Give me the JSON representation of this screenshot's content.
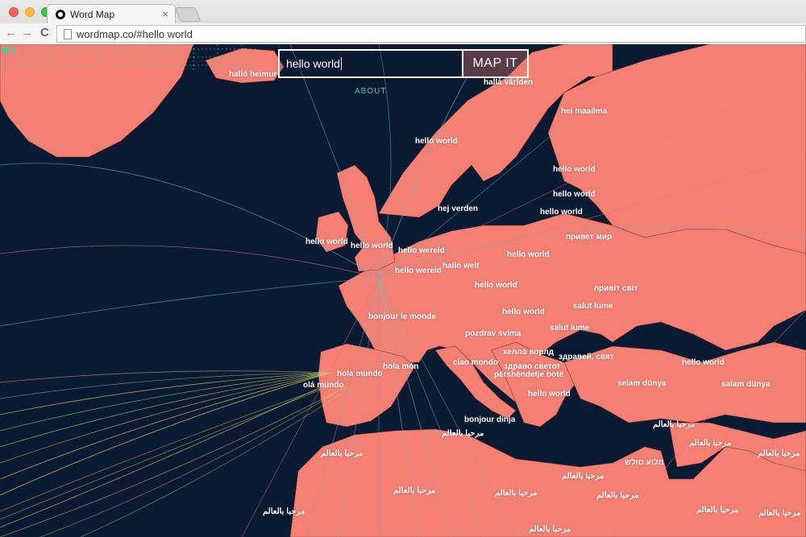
{
  "browser": {
    "tab_title": "Word Map",
    "tab_close": "×",
    "url": "wordmap.co/#hello world",
    "back_glyph": "←",
    "forward_glyph": "→",
    "reload_glyph": "C"
  },
  "app": {
    "search_value": "hello world",
    "map_button": "MAP IT",
    "about_link": "ABOUT"
  },
  "colors": {
    "land": "#f47f73",
    "sea": "#0b1a33",
    "accent": "#3ad0a2"
  },
  "labels": [
    {
      "text": "halló heimur"
    },
    {
      "text": "hallå världen"
    },
    {
      "text": "hei maailma"
    },
    {
      "text": "hello world"
    },
    {
      "text": "hello world"
    },
    {
      "text": "hello world"
    },
    {
      "text": "hej verden"
    },
    {
      "text": "hello world"
    },
    {
      "text": "hello world"
    },
    {
      "text": "hello wereld"
    },
    {
      "text": "привет мир"
    },
    {
      "text": "hello wereld"
    },
    {
      "text": "hallo welt"
    },
    {
      "text": "hello world"
    },
    {
      "text": "hello world"
    },
    {
      "text": "привіт світ"
    },
    {
      "text": "salut lume"
    },
    {
      "text": "hello world"
    },
    {
      "text": "bonjour le monde"
    },
    {
      "text": "salut lume"
    },
    {
      "text": "pozdrav svima"
    },
    {
      "text": "хелло ворлд"
    },
    {
      "text": "здравей, свят"
    },
    {
      "text": "ciao mondo"
    },
    {
      "text": "здраво светот"
    },
    {
      "text": "hola mundo"
    },
    {
      "text": "hola món"
    },
    {
      "text": "përshëndetje botë"
    },
    {
      "text": "hello world"
    },
    {
      "text": "olá mundo"
    },
    {
      "text": "hello world"
    },
    {
      "text": "selam dünya"
    },
    {
      "text": "salam dünya"
    },
    {
      "text": "bonjour dinja"
    },
    {
      "text": "مرحبا بالعالم"
    },
    {
      "text": "مرحبا بالعالم"
    },
    {
      "text": "مرحبا بالعالم"
    },
    {
      "text": "مرحبا بالعالم"
    },
    {
      "text": "مرحبا بالعالم"
    },
    {
      "text": "מלוע םולש"
    },
    {
      "text": "مرحبا بالعالم"
    },
    {
      "text": "مرحبا بالعالم"
    },
    {
      "text": "مرحبا بالعالم"
    },
    {
      "text": "مرحبا بالعالم"
    },
    {
      "text": "مرحبا بالعالم"
    },
    {
      "text": "مرحبا بالعالم"
    },
    {
      "text": "مرحبا بالعالم"
    },
    {
      "text": "مرحبا بالعالم"
    }
  ]
}
